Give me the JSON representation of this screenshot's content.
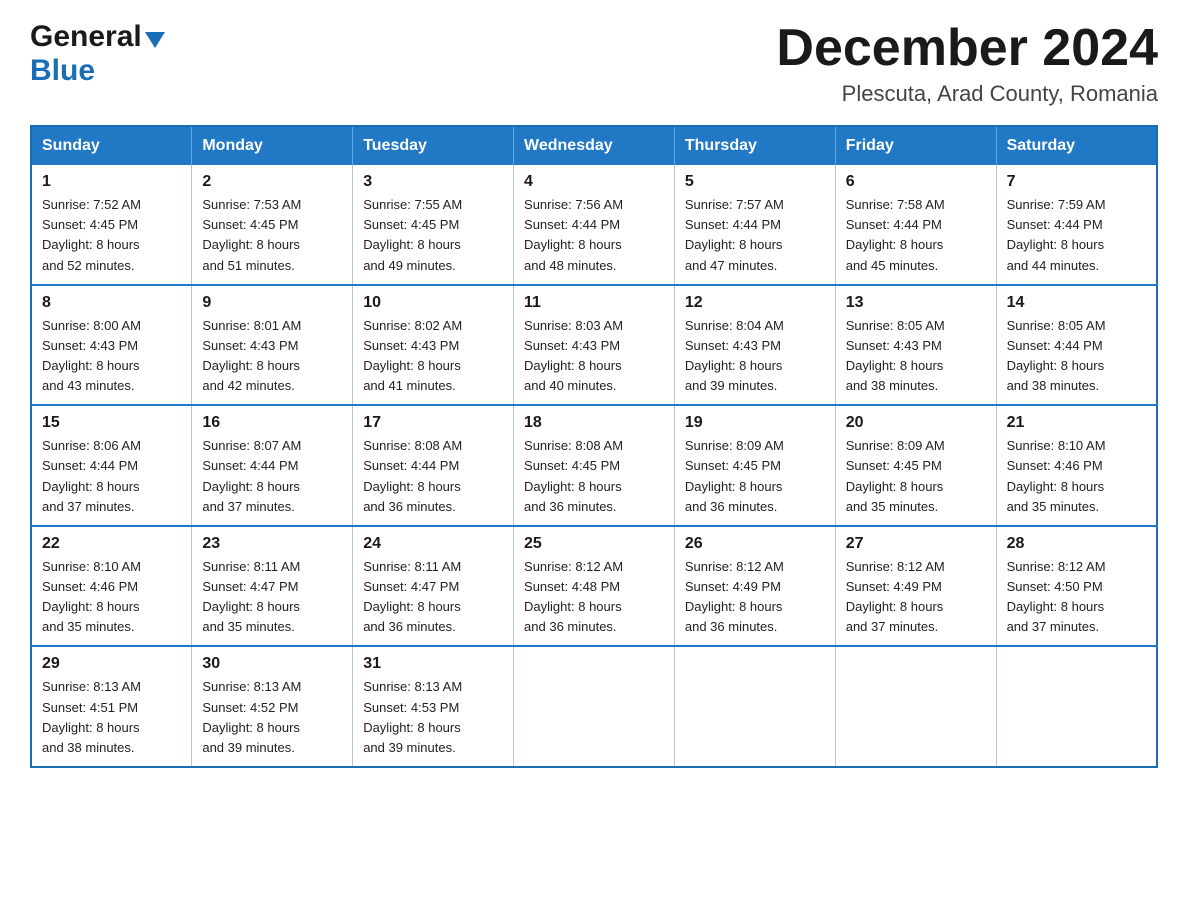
{
  "header": {
    "logo_general": "General",
    "logo_blue": "Blue",
    "month_title": "December 2024",
    "location": "Plescuta, Arad County, Romania"
  },
  "days_of_week": [
    "Sunday",
    "Monday",
    "Tuesday",
    "Wednesday",
    "Thursday",
    "Friday",
    "Saturday"
  ],
  "weeks": [
    [
      {
        "day": "1",
        "sunrise": "7:52 AM",
        "sunset": "4:45 PM",
        "daylight": "8 hours and 52 minutes."
      },
      {
        "day": "2",
        "sunrise": "7:53 AM",
        "sunset": "4:45 PM",
        "daylight": "8 hours and 51 minutes."
      },
      {
        "day": "3",
        "sunrise": "7:55 AM",
        "sunset": "4:45 PM",
        "daylight": "8 hours and 49 minutes."
      },
      {
        "day": "4",
        "sunrise": "7:56 AM",
        "sunset": "4:44 PM",
        "daylight": "8 hours and 48 minutes."
      },
      {
        "day": "5",
        "sunrise": "7:57 AM",
        "sunset": "4:44 PM",
        "daylight": "8 hours and 47 minutes."
      },
      {
        "day": "6",
        "sunrise": "7:58 AM",
        "sunset": "4:44 PM",
        "daylight": "8 hours and 45 minutes."
      },
      {
        "day": "7",
        "sunrise": "7:59 AM",
        "sunset": "4:44 PM",
        "daylight": "8 hours and 44 minutes."
      }
    ],
    [
      {
        "day": "8",
        "sunrise": "8:00 AM",
        "sunset": "4:43 PM",
        "daylight": "8 hours and 43 minutes."
      },
      {
        "day": "9",
        "sunrise": "8:01 AM",
        "sunset": "4:43 PM",
        "daylight": "8 hours and 42 minutes."
      },
      {
        "day": "10",
        "sunrise": "8:02 AM",
        "sunset": "4:43 PM",
        "daylight": "8 hours and 41 minutes."
      },
      {
        "day": "11",
        "sunrise": "8:03 AM",
        "sunset": "4:43 PM",
        "daylight": "8 hours and 40 minutes."
      },
      {
        "day": "12",
        "sunrise": "8:04 AM",
        "sunset": "4:43 PM",
        "daylight": "8 hours and 39 minutes."
      },
      {
        "day": "13",
        "sunrise": "8:05 AM",
        "sunset": "4:43 PM",
        "daylight": "8 hours and 38 minutes."
      },
      {
        "day": "14",
        "sunrise": "8:05 AM",
        "sunset": "4:44 PM",
        "daylight": "8 hours and 38 minutes."
      }
    ],
    [
      {
        "day": "15",
        "sunrise": "8:06 AM",
        "sunset": "4:44 PM",
        "daylight": "8 hours and 37 minutes."
      },
      {
        "day": "16",
        "sunrise": "8:07 AM",
        "sunset": "4:44 PM",
        "daylight": "8 hours and 37 minutes."
      },
      {
        "day": "17",
        "sunrise": "8:08 AM",
        "sunset": "4:44 PM",
        "daylight": "8 hours and 36 minutes."
      },
      {
        "day": "18",
        "sunrise": "8:08 AM",
        "sunset": "4:45 PM",
        "daylight": "8 hours and 36 minutes."
      },
      {
        "day": "19",
        "sunrise": "8:09 AM",
        "sunset": "4:45 PM",
        "daylight": "8 hours and 36 minutes."
      },
      {
        "day": "20",
        "sunrise": "8:09 AM",
        "sunset": "4:45 PM",
        "daylight": "8 hours and 35 minutes."
      },
      {
        "day": "21",
        "sunrise": "8:10 AM",
        "sunset": "4:46 PM",
        "daylight": "8 hours and 35 minutes."
      }
    ],
    [
      {
        "day": "22",
        "sunrise": "8:10 AM",
        "sunset": "4:46 PM",
        "daylight": "8 hours and 35 minutes."
      },
      {
        "day": "23",
        "sunrise": "8:11 AM",
        "sunset": "4:47 PM",
        "daylight": "8 hours and 35 minutes."
      },
      {
        "day": "24",
        "sunrise": "8:11 AM",
        "sunset": "4:47 PM",
        "daylight": "8 hours and 36 minutes."
      },
      {
        "day": "25",
        "sunrise": "8:12 AM",
        "sunset": "4:48 PM",
        "daylight": "8 hours and 36 minutes."
      },
      {
        "day": "26",
        "sunrise": "8:12 AM",
        "sunset": "4:49 PM",
        "daylight": "8 hours and 36 minutes."
      },
      {
        "day": "27",
        "sunrise": "8:12 AM",
        "sunset": "4:49 PM",
        "daylight": "8 hours and 37 minutes."
      },
      {
        "day": "28",
        "sunrise": "8:12 AM",
        "sunset": "4:50 PM",
        "daylight": "8 hours and 37 minutes."
      }
    ],
    [
      {
        "day": "29",
        "sunrise": "8:13 AM",
        "sunset": "4:51 PM",
        "daylight": "8 hours and 38 minutes."
      },
      {
        "day": "30",
        "sunrise": "8:13 AM",
        "sunset": "4:52 PM",
        "daylight": "8 hours and 39 minutes."
      },
      {
        "day": "31",
        "sunrise": "8:13 AM",
        "sunset": "4:53 PM",
        "daylight": "8 hours and 39 minutes."
      },
      null,
      null,
      null,
      null
    ]
  ],
  "labels": {
    "sunrise_prefix": "Sunrise: ",
    "sunset_prefix": "Sunset: ",
    "daylight_prefix": "Daylight: "
  }
}
